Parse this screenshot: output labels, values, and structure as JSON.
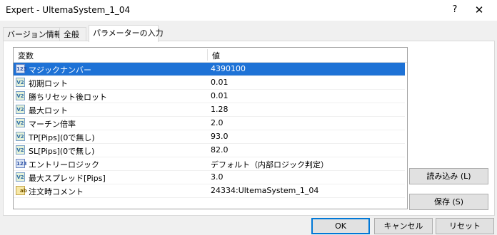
{
  "window": {
    "title": "Expert - UltemaSystem_1_04",
    "help_glyph": "?",
    "close_glyph": "✕"
  },
  "tabs": [
    {
      "label": "バージョン情報"
    },
    {
      "label": "全般"
    },
    {
      "label": "パラメーターの入力",
      "active": true
    }
  ],
  "grid": {
    "headers": {
      "variable": "変数",
      "value": "値"
    },
    "rows": [
      {
        "icon": "123",
        "name": "マジックナンバー",
        "value": "4390100",
        "selected": true
      },
      {
        "icon": "V2",
        "name": "初期ロット",
        "value": "0.01"
      },
      {
        "icon": "V2",
        "name": "勝ちリセット後ロット",
        "value": "0.01"
      },
      {
        "icon": "V2",
        "name": "最大ロット",
        "value": "1.28"
      },
      {
        "icon": "V2",
        "name": "マーチン倍率",
        "value": "2.0"
      },
      {
        "icon": "V2",
        "name": "TP[Pips](0で無し)",
        "value": "93.0"
      },
      {
        "icon": "V2",
        "name": "SL[Pips](0で無し)",
        "value": "82.0"
      },
      {
        "icon": "123",
        "name": "エントリーロジック",
        "value": "デフォルト（内部ロジック判定）"
      },
      {
        "icon": "V2",
        "name": "最大スプレッド[Pips]",
        "value": "3.0"
      },
      {
        "icon": "ab",
        "name": "注文時コメント",
        "value": "24334:UltemaSystem_1_04"
      }
    ]
  },
  "buttons": {
    "load": "読み込み (L)",
    "save": "保存 (S)",
    "ok": "OK",
    "cancel": "キャンセル",
    "reset": "リセット"
  },
  "colors": {
    "selection": "#1e72d6",
    "ok_border": "#0078d7"
  }
}
